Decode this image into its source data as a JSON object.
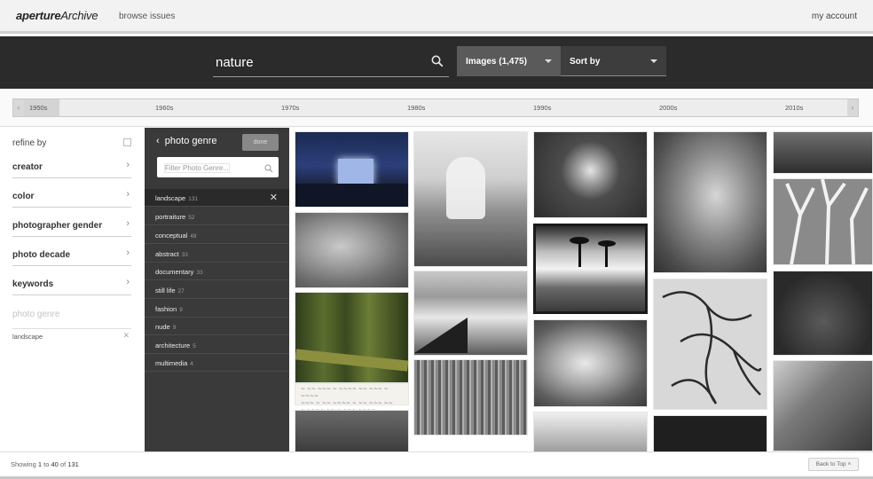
{
  "header": {
    "logo_part1": "aperture",
    "logo_part2": "Archive",
    "browse_label": "browse issues",
    "account_label": "my account"
  },
  "search": {
    "query": "nature",
    "type_dropdown": "Images (1,475)",
    "sort_dropdown": "Sort by"
  },
  "timeline": {
    "decades": [
      "1950s",
      "1960s",
      "1970s",
      "1980s",
      "1990s",
      "2000s",
      "2010s"
    ]
  },
  "sidebar": {
    "refine_label": "refine by",
    "facets": [
      "creator",
      "color",
      "photographer gender",
      "photo decade",
      "keywords"
    ],
    "active_facet": "photo genre",
    "active_chip": "landscape"
  },
  "genre_panel": {
    "title": "photo genre",
    "done_label": "done",
    "filter_placeholder": "Filter Photo Genre...",
    "items": [
      {
        "name": "landscape",
        "count": "131"
      },
      {
        "name": "portraiture",
        "count": "52"
      },
      {
        "name": "conceptual",
        "count": "48"
      },
      {
        "name": "abstract",
        "count": "33"
      },
      {
        "name": "documentary",
        "count": "33"
      },
      {
        "name": "still life",
        "count": "27"
      },
      {
        "name": "fashion",
        "count": "9"
      },
      {
        "name": "nude",
        "count": "9"
      },
      {
        "name": "architecture",
        "count": "5"
      },
      {
        "name": "multimedia",
        "count": "4"
      }
    ]
  },
  "footer": {
    "showing_prefix": "Showing",
    "range_start": "1",
    "to_word": "to",
    "range_end": "40",
    "of_word": "of",
    "total": "131",
    "back_to_top": "Back to Top"
  },
  "colors": {
    "search_bar_bg": "#2b2b2b",
    "panel_bg": "#3a3a3a",
    "dropdown_active_bg": "#5a5a5a"
  }
}
